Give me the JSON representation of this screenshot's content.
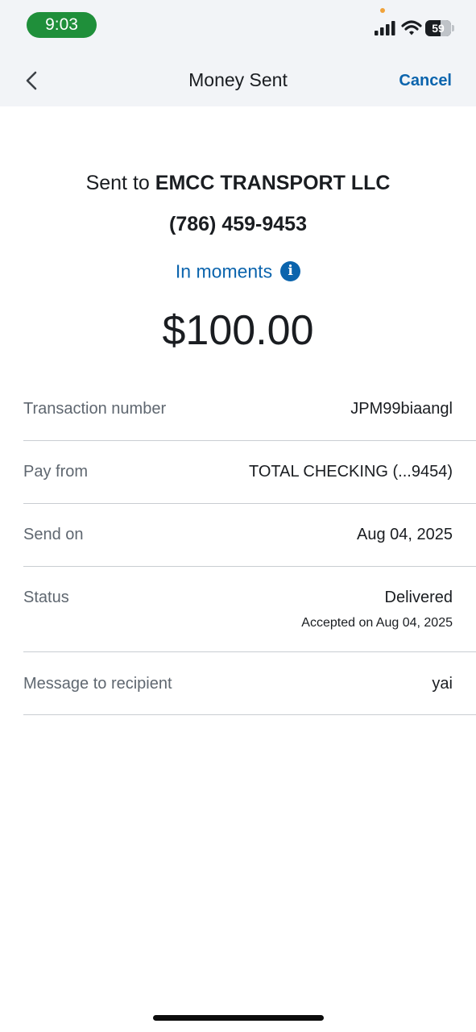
{
  "status_bar": {
    "time": "9:03",
    "battery": "59",
    "time_pill_color": "#1f8f3a"
  },
  "header": {
    "back_icon": "chevron-left-icon",
    "title": "Money Sent",
    "cancel_label": "Cancel"
  },
  "summary": {
    "sent_to_prefix": "Sent to",
    "recipient_name": "EMCC TRANSPORT LLC",
    "phone": "(786) 459-9453",
    "timing": "In moments",
    "info_icon": "info-icon",
    "amount": "$100.00"
  },
  "details": [
    {
      "label": "Transaction number",
      "value": "JPM99biaangl"
    },
    {
      "label": "Pay from",
      "value": "TOTAL CHECKING (...9454)"
    },
    {
      "label": "Send on",
      "value": "Aug 04, 2025"
    },
    {
      "label": "Status",
      "value": "Delivered",
      "subvalue": "Accepted on Aug 04, 2025"
    },
    {
      "label": "Message to recipient",
      "value": "yai"
    }
  ],
  "colors": {
    "accent": "#0b64ad",
    "header_bg": "#f2f4f7",
    "label_gray": "#5f6770"
  }
}
